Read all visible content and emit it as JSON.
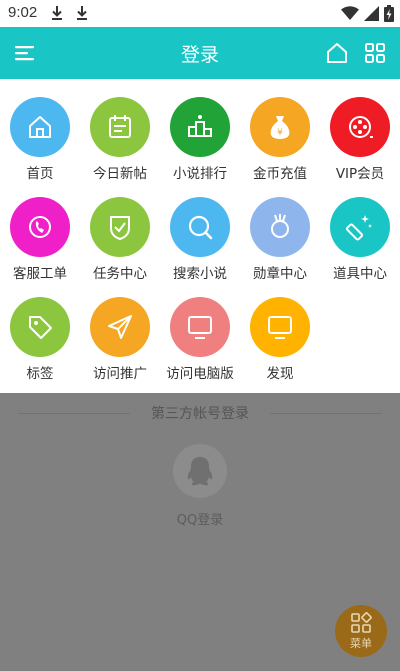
{
  "status_bar": {
    "time": "9:02",
    "icons": [
      "download-icon",
      "download-icon",
      "wifi-icon",
      "signal-icon",
      "battery-charging-icon"
    ]
  },
  "header": {
    "title": "登录",
    "left_icon": "menu-icon",
    "right_icons": [
      "home-icon",
      "grid-icon"
    ],
    "color": "#19c5c5"
  },
  "menu_grid": {
    "items": [
      {
        "label": "首页",
        "icon": "home-icon",
        "color": "#4db8f0"
      },
      {
        "label": "今日新帖",
        "icon": "calendar-icon",
        "color": "#8cc63f"
      },
      {
        "label": "小说排行",
        "icon": "podium-icon",
        "color": "#22a338"
      },
      {
        "label": "金币充值",
        "icon": "money-bag-icon",
        "color": "#f5a623"
      },
      {
        "label": "VIP会员",
        "icon": "vip-icon",
        "color": "#ef1c25"
      },
      {
        "label": "客服工单",
        "icon": "phone-icon",
        "color": "#f020c8"
      },
      {
        "label": "任务中心",
        "icon": "shield-check-icon",
        "color": "#8cc63f"
      },
      {
        "label": "搜索小说",
        "icon": "search-icon",
        "color": "#4db8f0"
      },
      {
        "label": "勋章中心",
        "icon": "medal-icon",
        "color": "#8fb6ec"
      },
      {
        "label": "道具中心",
        "icon": "magic-wand-icon",
        "color": "#19c5c5"
      },
      {
        "label": "标签",
        "icon": "tag-icon",
        "color": "#8cc63f"
      },
      {
        "label": "访问推广",
        "icon": "paper-plane-icon",
        "color": "#f5a623"
      },
      {
        "label": "访问电脑版",
        "icon": "monitor-icon",
        "color": "#f08080"
      },
      {
        "label": "发现",
        "icon": "monitor-icon",
        "color": "#ffb300"
      }
    ]
  },
  "third_party": {
    "title": "第三方帐号登录",
    "qq_label": "QQ登录"
  },
  "fab": {
    "label": "菜单",
    "icon": "grid-icon"
  }
}
